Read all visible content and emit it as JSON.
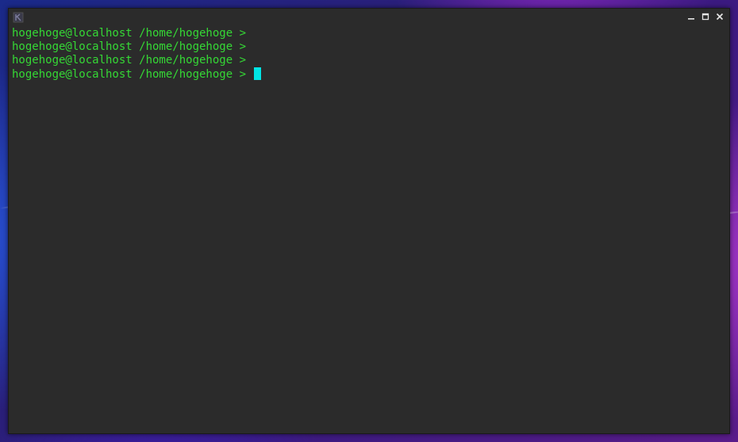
{
  "desktop": {
    "accent_blue": "#2a5ae6",
    "accent_purple": "#b43cdc"
  },
  "window": {
    "title_icon": "terminal-app-icon",
    "controls": {
      "minimize_icon": "minimize-icon",
      "maximize_icon": "maximize-icon",
      "close_icon": "close-icon"
    }
  },
  "terminal": {
    "background": "#2b2b2b",
    "text_color": "#35d835",
    "cursor_color": "#00e5e5",
    "lines": [
      "hogehoge@localhost /home/hogehoge > ",
      "hogehoge@localhost /home/hogehoge > ",
      "hogehoge@localhost /home/hogehoge > ",
      "hogehoge@localhost /home/hogehoge > "
    ]
  }
}
